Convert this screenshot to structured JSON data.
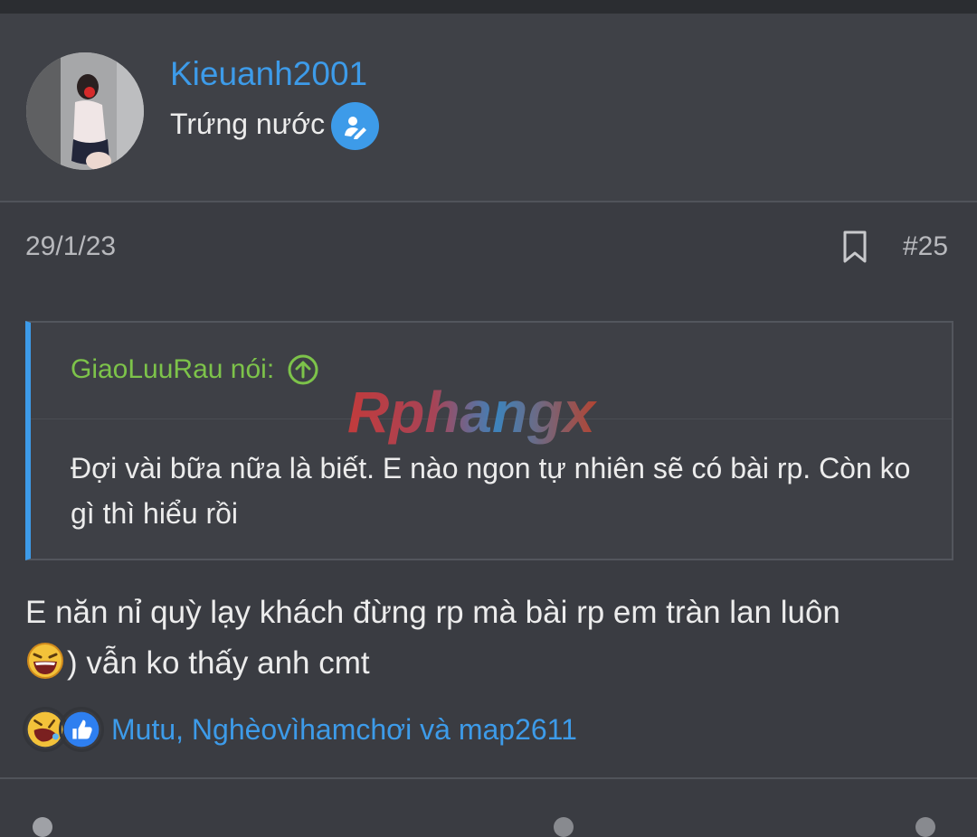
{
  "user": {
    "name": "Kieuanh2001",
    "title": "Trứng nước",
    "badge_icon": "user-edit-icon",
    "name_color": "#3d9be9"
  },
  "post": {
    "date": "29/1/23",
    "number": "#25",
    "bookmark_icon": "bookmark-icon"
  },
  "quote": {
    "author_label": "GiaoLuuRau nói:",
    "jump_icon": "arrow-up-circle-icon",
    "text": "Đợi vài bữa nữa là biết. E nào ngon tự nhiên sẽ có bài rp. Còn ko gì thì hiểu rồi",
    "author_color": "#7dc34a"
  },
  "watermark": {
    "text": "Rphangx"
  },
  "message": {
    "line1": "E năn nỉ quỳ lạy khách đừng rp mà bài rp em tràn lan luôn",
    "emoji": "laughing-emoji-icon",
    "line2": ") vẫn ko thấy anh cmt"
  },
  "reactions": {
    "icons": [
      "haha-reaction-icon",
      "like-reaction-icon"
    ],
    "names": "Mutu, Nghèovìhamchơi và map2611"
  }
}
